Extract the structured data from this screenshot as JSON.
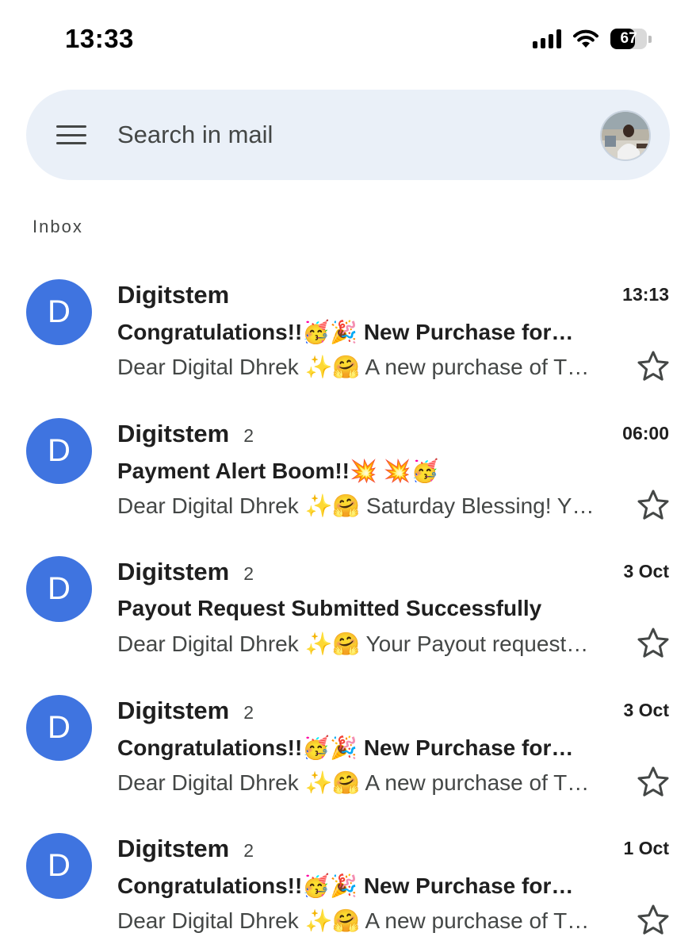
{
  "status_bar": {
    "time": "13:33",
    "battery": "67",
    "battery_level": 0.67,
    "icons": [
      "cellular-signal-icon",
      "wifi-icon",
      "battery-icon"
    ]
  },
  "search": {
    "placeholder": "Search in mail",
    "menu_icon": "hamburger-menu-icon",
    "avatar": "profile-avatar"
  },
  "inbox_label": "Inbox",
  "colors": {
    "avatar_bg": "#3f74e0",
    "search_bg": "#eaf0f8",
    "text_primary": "#1f1f1f",
    "text_secondary": "#444746"
  },
  "emails": [
    {
      "initial": "D",
      "sender": "Digitstem",
      "count": "",
      "time": "13:13",
      "subject": "Congratulations!!🥳🎉 New Purchase for…",
      "snippet": "Dear Digital Dhrek ✨🤗 A new purchase of T…"
    },
    {
      "initial": "D",
      "sender": "Digitstem",
      "count": "2",
      "time": "06:00",
      "subject": "Payment Alert Boom!!💥 💥🥳",
      "snippet": "Dear Digital Dhrek ✨🤗 Saturday Blessing! Y…"
    },
    {
      "initial": "D",
      "sender": "Digitstem",
      "count": "2",
      "time": "3 Oct",
      "subject": "Payout Request Submitted Successfully",
      "snippet": "Dear Digital Dhrek ✨🤗 Your Payout request…"
    },
    {
      "initial": "D",
      "sender": "Digitstem",
      "count": "2",
      "time": "3 Oct",
      "subject": "Congratulations!!🥳🎉 New Purchase for…",
      "snippet": "Dear Digital Dhrek ✨🤗 A new purchase of T…"
    },
    {
      "initial": "D",
      "sender": "Digitstem",
      "count": "2",
      "time": "1 Oct",
      "subject": "Congratulations!!🥳🎉 New Purchase for…",
      "snippet": "Dear Digital Dhrek ✨🤗 A new purchase of T…"
    }
  ]
}
